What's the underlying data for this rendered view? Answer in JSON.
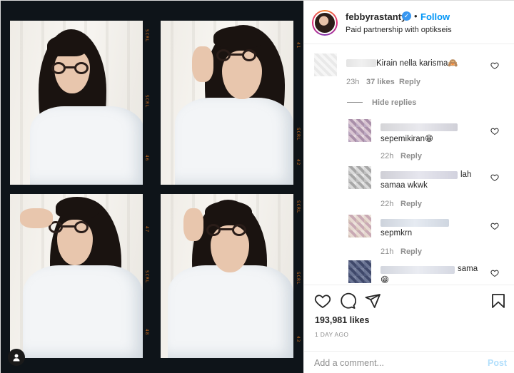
{
  "post": {
    "username": "febbyrastanty",
    "follow_label": "Follow",
    "dot": "•",
    "partnership": "Paid partnership with optikseis",
    "likes": "193,981 likes",
    "date": "1 DAY AGO"
  },
  "photo": {
    "edge_labels": [
      "SCRL",
      "46",
      "SCRL",
      "41",
      "SCRL",
      "42",
      "47",
      "SCRL",
      "SCRL",
      "48",
      "SCRL",
      "43"
    ]
  },
  "comments": {
    "main": {
      "text": "Kirain nella karisma🙈",
      "time": "23h",
      "likes": "37 likes",
      "reply": "Reply"
    },
    "hide_replies": "Hide replies",
    "replies": [
      {
        "text": "sepemikiran😁",
        "time": "22h",
        "reply": "Reply"
      },
      {
        "text": "lah",
        "text2": "samaa wkwk",
        "time": "22h",
        "reply": "Reply"
      },
      {
        "text": "sepmkrn",
        "time": "21h",
        "reply": "Reply"
      },
      {
        "text": "sama",
        "text2": "😁",
        "time": "",
        "reply": ""
      }
    ]
  },
  "composer": {
    "placeholder": "Add a comment...",
    "post_label": "Post"
  },
  "colors": {
    "link_blue": "#0095f6",
    "verified_blue": "#3897f0",
    "muted": "#8e8e8e",
    "post_disabled": "#b2dffc"
  }
}
